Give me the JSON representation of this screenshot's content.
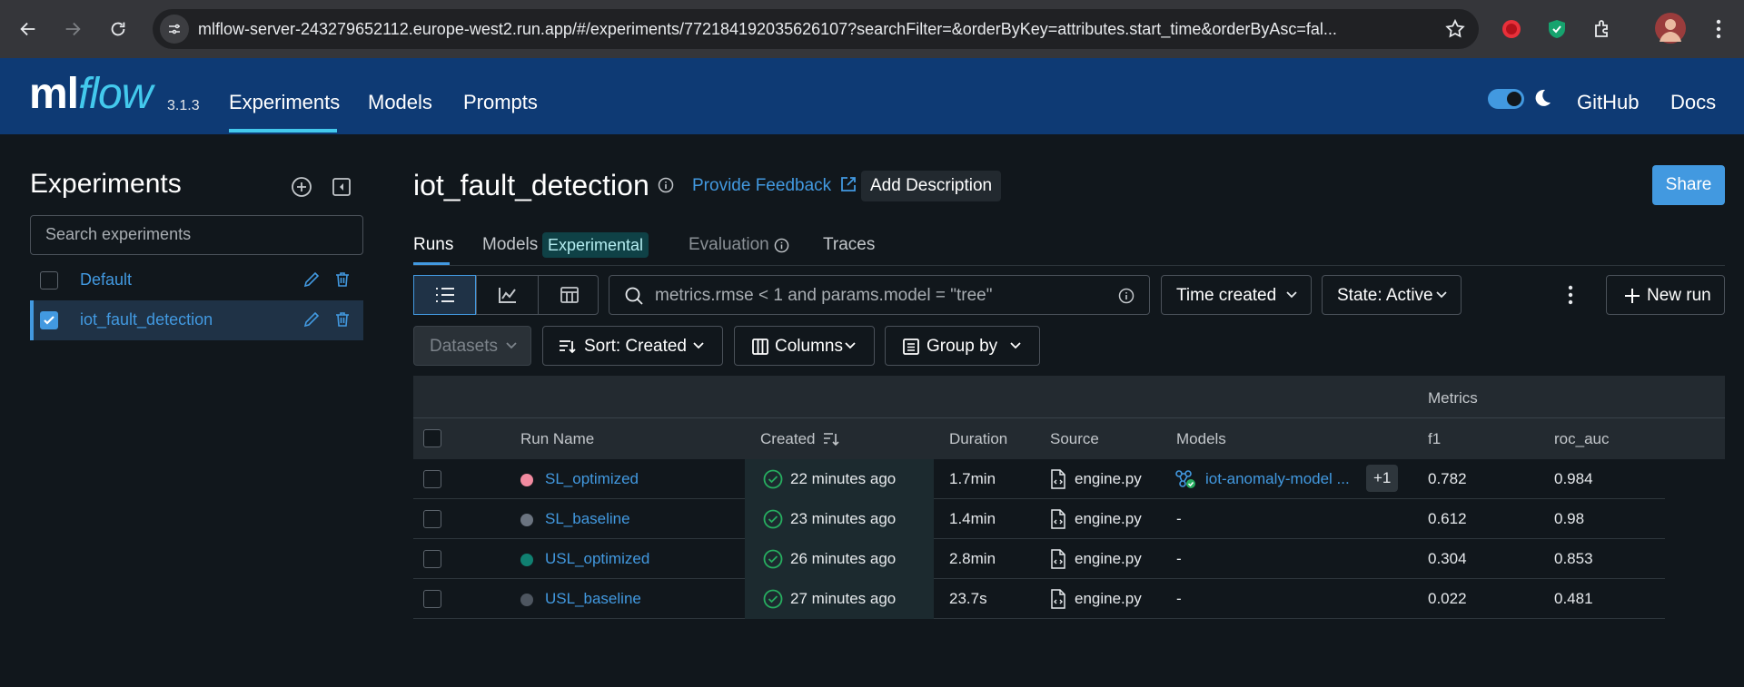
{
  "browser": {
    "url": "mlflow-server-243279652112.europe-west2.run.app/#/experiments/772184192035626107?searchFilter=&orderByKey=attributes.start_time&orderByAsc=fal..."
  },
  "header": {
    "logo_ml": "ml",
    "logo_flow": "flow",
    "version": "3.1.3",
    "nav": [
      "Experiments",
      "Models",
      "Prompts"
    ],
    "github": "GitHub",
    "docs": "Docs"
  },
  "sidebar": {
    "title": "Experiments",
    "search_placeholder": "Search experiments",
    "experiments": [
      {
        "name": "Default",
        "checked": false
      },
      {
        "name": "iot_fault_detection",
        "checked": true
      }
    ]
  },
  "main": {
    "title": "iot_fault_detection",
    "feedback": "Provide Feedback",
    "add_description": "Add Description",
    "share": "Share",
    "tabs": [
      "Runs",
      "Models",
      "Evaluation",
      "Traces"
    ],
    "experimental_badge": "Experimental",
    "search_placeholder": "metrics.rmse < 1 and params.model = \"tree\"",
    "time_created": "Time created",
    "state": "State: Active",
    "new_run": "New run",
    "datasets": "Datasets",
    "sort": "Sort: Created",
    "columns": "Columns",
    "group_by": "Group by"
  },
  "table": {
    "metrics_group": "Metrics",
    "headers": {
      "run_name": "Run Name",
      "created": "Created",
      "duration": "Duration",
      "source": "Source",
      "models": "Models",
      "f1": "f1",
      "roc_auc": "roc_auc"
    },
    "rows": [
      {
        "name": "SL_optimized",
        "color": "#f28ba0",
        "created": "22 minutes ago",
        "duration": "1.7min",
        "source": "engine.py",
        "model": "iot-anomaly-model ...",
        "extra_models": "+1",
        "f1": "0.782",
        "roc_auc": "0.984"
      },
      {
        "name": "SL_baseline",
        "color": "#6b7480",
        "created": "23 minutes ago",
        "duration": "1.4min",
        "source": "engine.py",
        "model": "-",
        "extra_models": "",
        "f1": "0.612",
        "roc_auc": "0.98"
      },
      {
        "name": "USL_optimized",
        "color": "#108071",
        "created": "26 minutes ago",
        "duration": "2.8min",
        "source": "engine.py",
        "model": "-",
        "extra_models": "",
        "f1": "0.304",
        "roc_auc": "0.853"
      },
      {
        "name": "USL_baseline",
        "color": "#4e5660",
        "created": "27 minutes ago",
        "duration": "23.7s",
        "source": "engine.py",
        "model": "-",
        "extra_models": "",
        "f1": "0.022",
        "roc_auc": "0.481"
      }
    ]
  },
  "colors": {
    "accent": "#4299e0",
    "header_bg": "#0e3a74",
    "page_bg": "#11171c",
    "success": "#27ae60"
  }
}
